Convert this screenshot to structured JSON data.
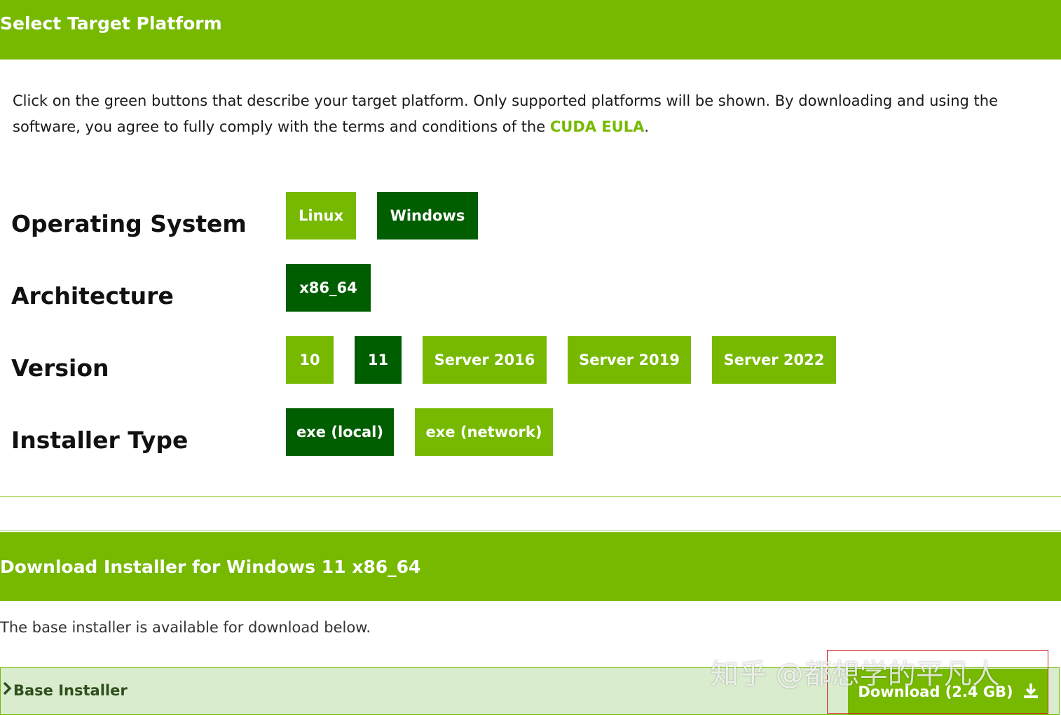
{
  "header": {
    "title": "Select Target Platform"
  },
  "intro": {
    "text": "Click on the green buttons that describe your target platform. Only supported platforms will be shown. By downloading and using the software, you agree to fully comply with the terms and conditions of the",
    "link": "CUDA EULA",
    "tail": "."
  },
  "rows": {
    "os": {
      "label": "Operating System",
      "options": [
        "Linux",
        "Windows"
      ],
      "selected": "Windows"
    },
    "arch": {
      "label": "Architecture",
      "options": [
        "x86_64"
      ],
      "selected": "x86_64"
    },
    "version": {
      "label": "Version",
      "options": [
        "10",
        "11",
        "Server 2016",
        "Server 2019",
        "Server 2022"
      ],
      "selected": "11"
    },
    "installer": {
      "label": "Installer Type",
      "options": [
        "exe (local)",
        "exe (network)"
      ],
      "selected": "exe (local)"
    }
  },
  "download": {
    "title": "Download Installer for Windows 11 x86_64",
    "note": "The base installer is available for download below.",
    "base_label": "Base Installer",
    "button_label": "Download (2.4 GB)"
  },
  "watermark": "知乎 @都想学的平凡人",
  "colors": {
    "accent": "#76b900",
    "selected": "#005e00",
    "base_bar": "#d9ecce",
    "highlight_box": "#d62020"
  },
  "icons": {
    "chevron": "chevron-right-icon",
    "download": "download-icon"
  }
}
